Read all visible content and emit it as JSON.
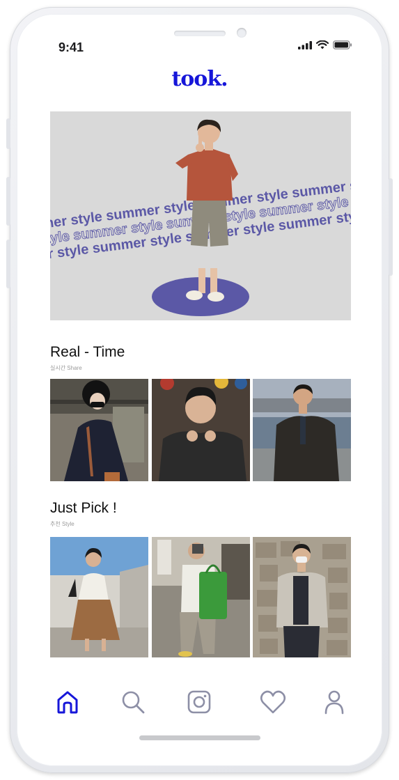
{
  "status_bar": {
    "time": "9:41",
    "signal_icon": "cellular-signal-icon",
    "wifi_icon": "wifi-icon",
    "battery_icon": "battery-icon"
  },
  "logo": {
    "text": "took."
  },
  "hero": {
    "band_text": "mmer style summer style summer style summer style summer style summer style summer style",
    "accent_color": "#5b58a6",
    "background_color": "#d9d9d9"
  },
  "sections": {
    "realtime": {
      "title": "Real - Time",
      "subtitle": "실시간 Share"
    },
    "justpick": {
      "title": "Just Pick !",
      "subtitle": "추천 Style"
    }
  },
  "tabs": [
    {
      "name": "home",
      "icon": "home-icon",
      "active": true
    },
    {
      "name": "search",
      "icon": "search-icon",
      "active": false
    },
    {
      "name": "instagram",
      "icon": "instagram-icon",
      "active": false
    },
    {
      "name": "likes",
      "icon": "heart-icon",
      "active": false
    },
    {
      "name": "profile",
      "icon": "person-icon",
      "active": false
    }
  ],
  "colors": {
    "brand": "#1616d9",
    "tab_inactive": "#8d8fa6",
    "text": "#111111"
  }
}
